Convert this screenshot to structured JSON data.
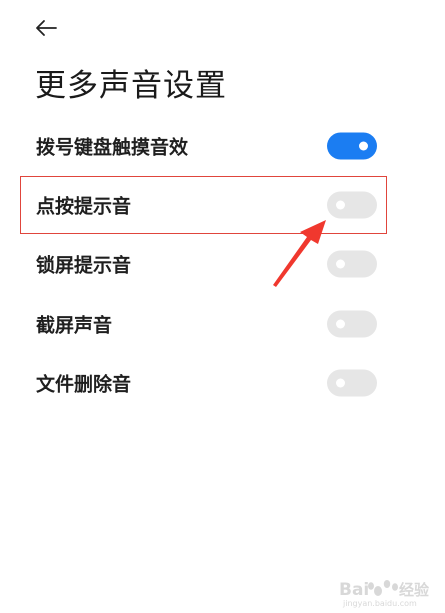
{
  "header": {
    "back_icon": "arrow-left-icon",
    "title": "更多声音设置"
  },
  "settings": [
    {
      "label": "拨号键盘触摸音效",
      "enabled": true
    },
    {
      "label": "点按提示音",
      "enabled": false
    },
    {
      "label": "锁屏提示音",
      "enabled": false
    },
    {
      "label": "截屏声音",
      "enabled": false
    },
    {
      "label": "文件删除音",
      "enabled": false
    }
  ],
  "annotation": {
    "highlight_color": "#e0453c",
    "arrow_color": "#f0382e"
  },
  "colors": {
    "toggle_on": "#1b7df2",
    "toggle_off": "#e6e6e6"
  },
  "watermark": {
    "brand": "Bai",
    "brand_suffix": "经验",
    "url": "jingyan.baidu.com"
  }
}
